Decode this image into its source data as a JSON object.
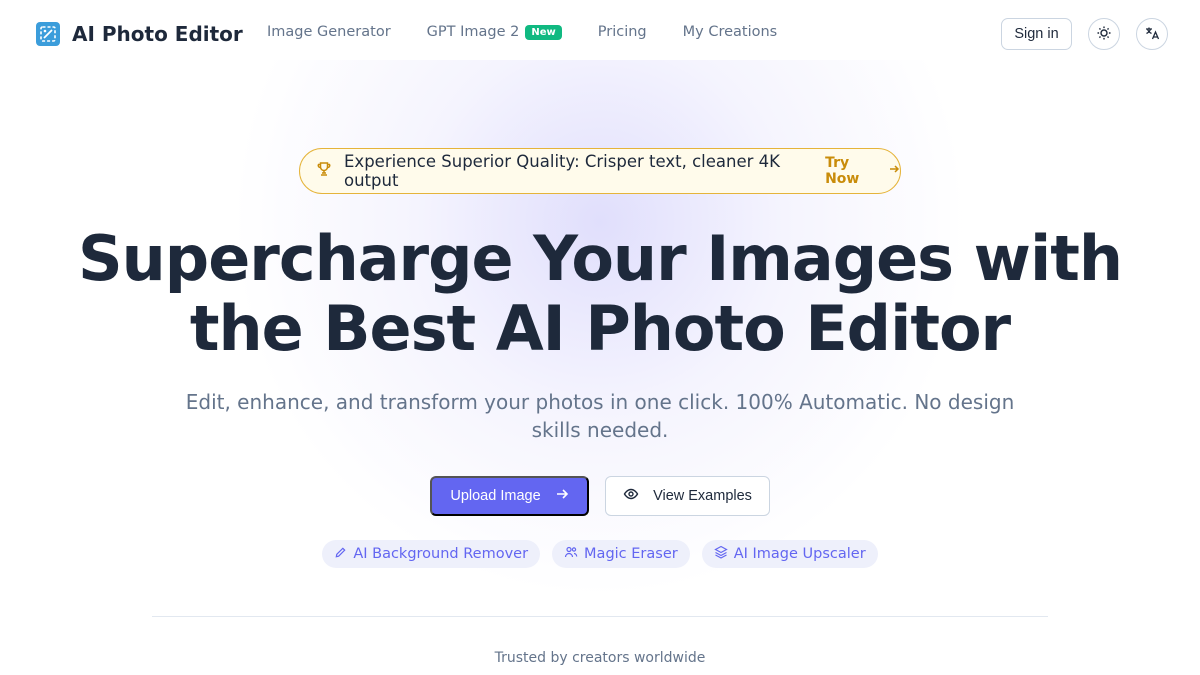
{
  "brand": {
    "name": "AI Photo Editor",
    "logo_icon": "image-edit-icon",
    "accent": "#6366f1",
    "logo_color": "#3b9ddb"
  },
  "nav": {
    "links": [
      {
        "label": "Image Generator"
      },
      {
        "label": "GPT Image 2",
        "badge": "New"
      },
      {
        "label": "Pricing"
      },
      {
        "label": "My Creations"
      }
    ],
    "sign_in": "Sign in",
    "theme_icon": "sun-icon",
    "language_icon": "translate-icon"
  },
  "promo": {
    "icon": "trophy-icon",
    "text": "Experience Superior Quality: Crisper text, cleaner 4K output",
    "cta": "Try Now",
    "cta_icon": "arrow-right-icon",
    "color": "#c98c0a"
  },
  "hero": {
    "title_line1": "Supercharge Your Images with",
    "title_line2": "the Best AI Photo Editor",
    "subtitle": "Edit, enhance, and transform your photos in one click. 100% Automatic. No design skills needed.",
    "primary_button": "Upload Image",
    "secondary_button": "View Examples"
  },
  "features": [
    {
      "label": "AI Background Remover",
      "icon": "pencil-icon"
    },
    {
      "label": "Magic Eraser",
      "icon": "users-icon"
    },
    {
      "label": "AI Image Upscaler",
      "icon": "layers-icon"
    }
  ],
  "footer": {
    "trusted": "Trusted by creators worldwide"
  }
}
